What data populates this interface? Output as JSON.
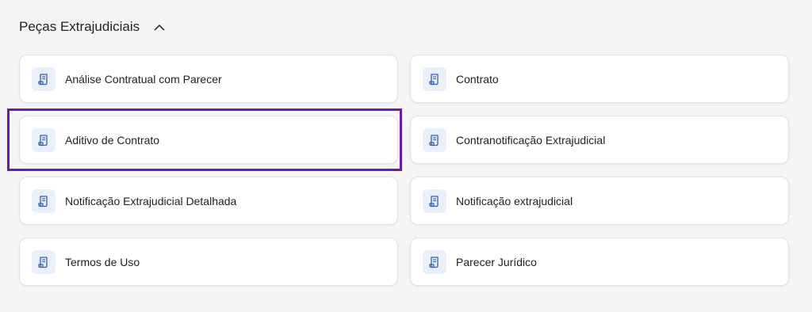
{
  "section": {
    "title": "Peças Extrajudiciais",
    "toggle_icon": "chevron-up-icon"
  },
  "colors": {
    "highlight": "#6a1ba8",
    "icon_bg": "#eaf0fb",
    "icon_fg": "#2f5fb3"
  },
  "items": [
    {
      "label": "Análise Contratual com Parecer",
      "icon": "document-scroll-icon"
    },
    {
      "label": "Contrato",
      "icon": "document-scroll-icon"
    },
    {
      "label": "Aditivo de Contrato",
      "icon": "document-scroll-icon",
      "highlighted": true
    },
    {
      "label": "Contranotificação Extrajudicial",
      "icon": "document-scroll-icon"
    },
    {
      "label": "Notificação Extrajudicial Detalhada",
      "icon": "document-scroll-icon"
    },
    {
      "label": "Notificação extrajudicial",
      "icon": "document-scroll-icon"
    },
    {
      "label": "Termos de Uso",
      "icon": "document-scroll-icon"
    },
    {
      "label": "Parecer Jurídico",
      "icon": "document-scroll-icon"
    }
  ]
}
